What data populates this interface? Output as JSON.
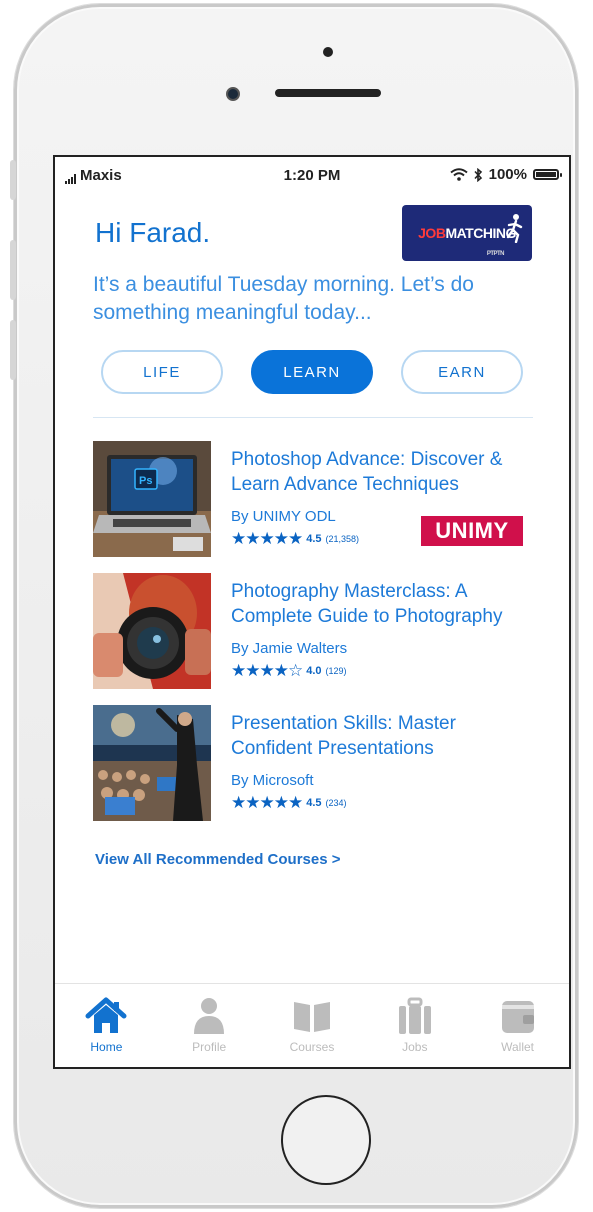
{
  "status_bar": {
    "carrier": "Maxis",
    "time": "1:20 PM",
    "battery": "100%"
  },
  "header": {
    "greeting": "Hi Farad.",
    "logo_text_1": "JOB",
    "logo_text_2": "MATCHING",
    "logo_tag": "PTPTN",
    "subtitle": "It’s a beautiful Tuesday morning. Let’s do something meaningful today..."
  },
  "segments": [
    {
      "label": "LIFE",
      "active": false
    },
    {
      "label": "LEARN",
      "active": true
    },
    {
      "label": "EARN",
      "active": false
    }
  ],
  "courses": [
    {
      "title": "Photoshop Advance: Discover & Learn Advance Techniques",
      "author": "By UNIMY ODL",
      "stars": "★★★★★",
      "rating": "4.5",
      "count": "(21,358)",
      "badge": "UNIMY"
    },
    {
      "title": "Photography Masterclass: A Complete Guide to Photography",
      "author": "By Jamie Walters",
      "stars": "★★★★☆",
      "rating": "4.0",
      "count": "(129)"
    },
    {
      "title": "Presentation Skills: Master Confident Presentations",
      "author": "By Microsoft",
      "stars": "★★★★★",
      "rating": "4.5",
      "count": "(234)"
    }
  ],
  "view_all": "View All Recommended Courses >",
  "tabbar": {
    "items": [
      {
        "label": "Home",
        "icon": "home-icon",
        "active": true
      },
      {
        "label": "Profile",
        "icon": "person-icon",
        "active": false
      },
      {
        "label": "Courses",
        "icon": "book-icon",
        "active": false
      },
      {
        "label": "Jobs",
        "icon": "briefcase-icon",
        "active": false
      },
      {
        "label": "Wallet",
        "icon": "wallet-icon",
        "active": false
      }
    ]
  },
  "colors": {
    "accent": "#1272cf",
    "active_pill": "#0a73d9",
    "badge": "#d0104b",
    "logo_bg": "#1e2a78",
    "inactive_tab": "#bcbcbc"
  }
}
